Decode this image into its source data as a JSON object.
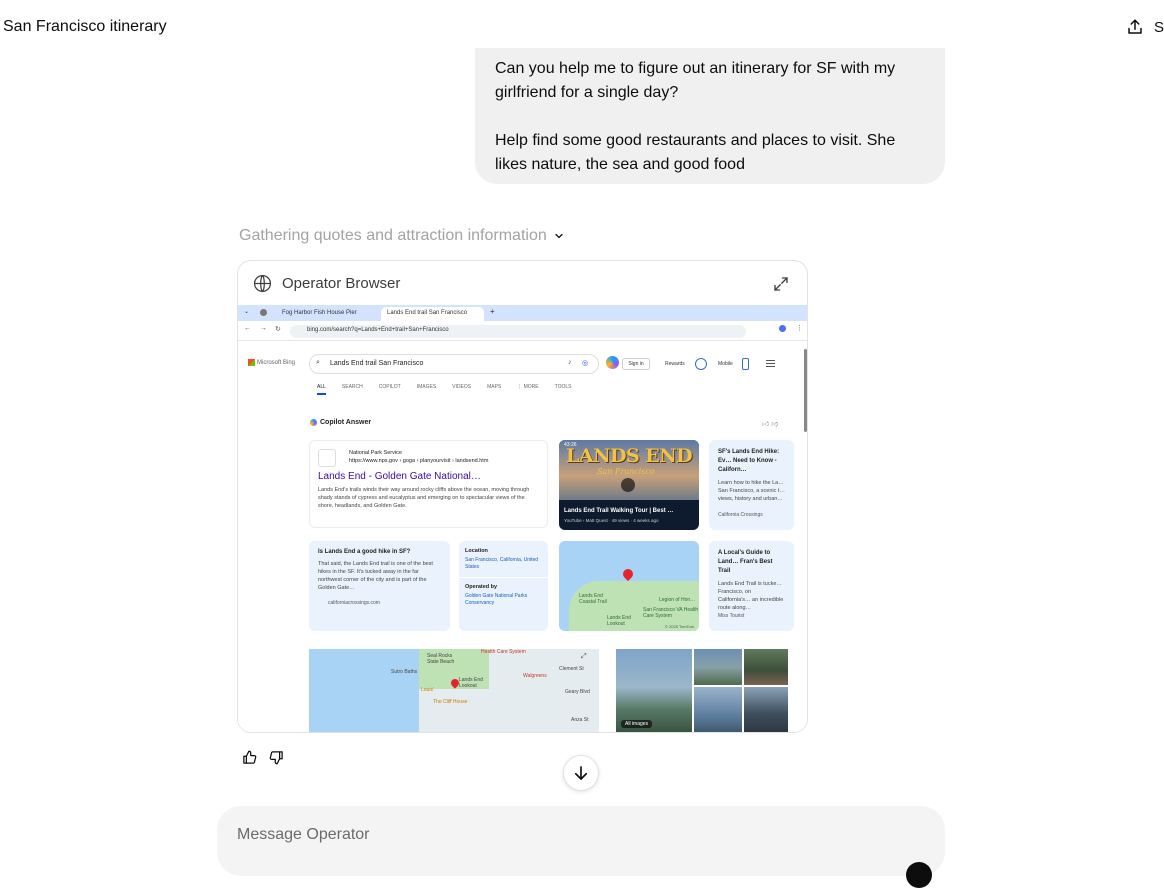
{
  "header": {
    "title": "San Francisco itinerary",
    "share_label": "Share"
  },
  "user_message": {
    "para1": "Can you help me to figure out an itinerary for SF with my girlfriend for a single day?",
    "para2": "Help find some good restaurants and places to visit. She likes nature, the sea and good food"
  },
  "status": {
    "gathering": "Gathering quotes and attraction information"
  },
  "operator": {
    "title": "Operator Browser",
    "browser": {
      "tabs": [
        {
          "label": "Fog Harbor Fish House Pier"
        },
        {
          "label": "Lands End trail San Francisco"
        }
      ],
      "url": "bing.com/search?q=Lands+End+trail+San+Francisco",
      "bing_logo": "Microsoft Bing",
      "search_query": "Lands End trail San Francisco",
      "sign_in": "Sign in",
      "rewards": "Rewards",
      "mobile": "Mobile",
      "nav_tabs": [
        "ALL",
        "SEARCH",
        "COPILOT",
        "IMAGES",
        "VIDEOS",
        "MAPS",
        "⋮ MORE",
        "TOOLS"
      ],
      "copilot_answer": "Copilot Answer",
      "result1": {
        "source": "National Park Service",
        "source_url": "https://www.nps.gov › goga › planyourvisit › landsend.htm",
        "heading": "Lands End - Golden Gate National…",
        "body": "Lands End's trails winds their way around rocky cliffs above the ocean, moving through shady stands of cypress and eucalyptus and emerging on to spectacular views of the shore, headlands, and Golden Gate."
      },
      "video": {
        "duration": "43:26",
        "art_title": "LANDS END",
        "art_sub": "San Francisco",
        "caption": "Lands End Trail Walking Tour | Best …",
        "meta": "YouTube › Matt Quest · 49 views · 4 weeks ago"
      },
      "result3": {
        "heading": "SF's Lands End Hike: Ev… Need to Know - Californ…",
        "body": "Learn how to hike the La… San Francisco, a scenic t… views, history and urban…",
        "footer": "California Crossings"
      },
      "qa": {
        "heading": "Is Lands End a good hike in SF?",
        "body": "That said, the Lands End trail is one of the best hikes in the SF. It's tucked away in the far northwest corner of the city and is part of the Golden Gate…",
        "footer": "californiacrossings.com"
      },
      "info": {
        "location_label": "Location",
        "location_value": "San Francisco, California, United States",
        "operated_label": "Operated by",
        "operated_value": "Golden Gate National Parks Conservancy"
      },
      "map_labels": [
        "Lands End Coastal Trail",
        "Legion of Hon…",
        "San Francisco VA Health Care System",
        "Lands End Lookout",
        "© 2025 TomTom"
      ],
      "result4": {
        "heading": "A Local's Guide to Land… Fran's Best Trail",
        "body": "Lands End Trail is tucke… Francisco, on California's… an incredible route along…",
        "footer": "Miss Tourist"
      },
      "map2_labels": [
        "Seal Rocks State Beach",
        "Sutro Baths",
        "Lands End Lookout",
        "Health Care System",
        "Walgreens",
        "Geary Blvd",
        "Louis'",
        "The Cliff House",
        "Anza St",
        "Clement St"
      ],
      "all_images": "All images"
    }
  },
  "composer": {
    "placeholder": "Message Operator"
  },
  "colors": {
    "bubble_bg": "#f0f0f0",
    "link_purple": "#4007a2",
    "bing_blue": "#174ae4"
  }
}
